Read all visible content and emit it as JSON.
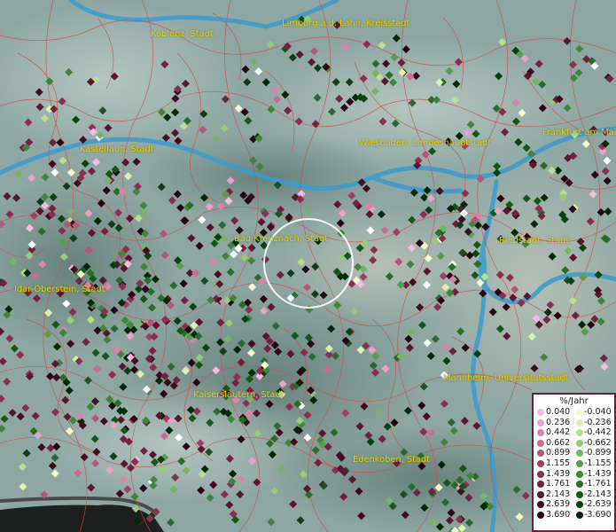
{
  "colors": {
    "terrain": "#8fa6a2",
    "river": "#3a9bd0",
    "borders": "#d8494a",
    "label": "#e6d000",
    "legend_border": "#6b1e3a"
  },
  "cities": [
    {
      "id": "koblenz",
      "name": "Koblenz, Stadt"
    },
    {
      "id": "limburg",
      "name": "Limburg a.d. Lahn, Kreisstadt"
    },
    {
      "id": "kastellaun",
      "name": "Kastellaun, Stadt"
    },
    {
      "id": "wiesbaden",
      "name": "Wiesbaden, Landeshauptstadt"
    },
    {
      "id": "frankfurt",
      "name": "Frankfurt am Main"
    },
    {
      "id": "badkreuznach",
      "name": "Bad Kreuznach, Stadt"
    },
    {
      "id": "riedstadt",
      "name": "Riedstadt, Stadt"
    },
    {
      "id": "idaroberstein",
      "name": "Idar-Oberstein, Stadt"
    },
    {
      "id": "kaiserslautern",
      "name": "Kaiserslautern, Stadt"
    },
    {
      "id": "mannheim",
      "name": "Mannheim, Universitätsstadt"
    },
    {
      "id": "edenkoben",
      "name": "Edenkoben, Stadt"
    }
  ],
  "legend": {
    "title": "%/Jahr",
    "positive": [
      {
        "label": "0.040",
        "color": "#f6b8e4"
      },
      {
        "label": "0.236",
        "color": "#ec9fcb"
      },
      {
        "label": "0.442",
        "color": "#dd82ad"
      },
      {
        "label": "0.662",
        "color": "#cc6b92"
      },
      {
        "label": "0.899",
        "color": "#b8547a"
      },
      {
        "label": "1.155",
        "color": "#a23f64"
      },
      {
        "label": "1.439",
        "color": "#8c2e51"
      },
      {
        "label": "1.761",
        "color": "#742040"
      },
      {
        "label": "2.143",
        "color": "#5c1430"
      },
      {
        "label": "2.639",
        "color": "#440a22"
      },
      {
        "label": "3.690",
        "color": "#2a0212"
      }
    ],
    "negative": [
      {
        "label": "-0.040",
        "color": "#f4fbc9"
      },
      {
        "label": "-0.236",
        "color": "#d9f2ac"
      },
      {
        "label": "-0.442",
        "color": "#b8e08c"
      },
      {
        "label": "-0.662",
        "color": "#95cc74"
      },
      {
        "label": "-0.899",
        "color": "#76b65e"
      },
      {
        "label": "-1.155",
        "color": "#589e4a"
      },
      {
        "label": "-1.439",
        "color": "#3e8638"
      },
      {
        "label": "-1.761",
        "color": "#276e28"
      },
      {
        "label": "-2.143",
        "color": "#145818"
      },
      {
        "label": "-2.639",
        "color": "#07430c"
      },
      {
        "label": "-3.690",
        "color": "#012a03"
      }
    ],
    "neutral_color": "#ffffff"
  }
}
